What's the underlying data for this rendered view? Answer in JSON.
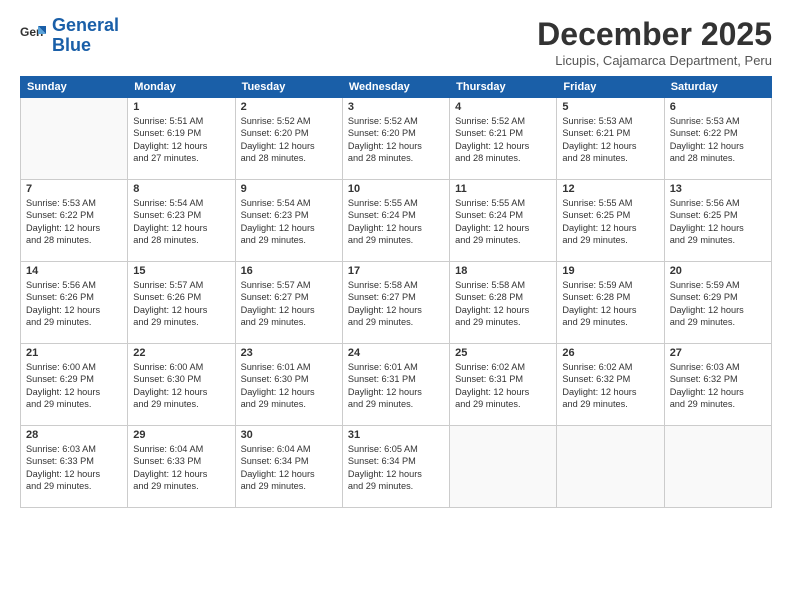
{
  "header": {
    "logo_line1": "General",
    "logo_line2": "Blue",
    "title": "December 2025",
    "subtitle": "Licupis, Cajamarca Department, Peru"
  },
  "days_of_week": [
    "Sunday",
    "Monday",
    "Tuesday",
    "Wednesday",
    "Thursday",
    "Friday",
    "Saturday"
  ],
  "weeks": [
    [
      {
        "num": "",
        "info": ""
      },
      {
        "num": "1",
        "info": "Sunrise: 5:51 AM\nSunset: 6:19 PM\nDaylight: 12 hours\nand 27 minutes."
      },
      {
        "num": "2",
        "info": "Sunrise: 5:52 AM\nSunset: 6:20 PM\nDaylight: 12 hours\nand 28 minutes."
      },
      {
        "num": "3",
        "info": "Sunrise: 5:52 AM\nSunset: 6:20 PM\nDaylight: 12 hours\nand 28 minutes."
      },
      {
        "num": "4",
        "info": "Sunrise: 5:52 AM\nSunset: 6:21 PM\nDaylight: 12 hours\nand 28 minutes."
      },
      {
        "num": "5",
        "info": "Sunrise: 5:53 AM\nSunset: 6:21 PM\nDaylight: 12 hours\nand 28 minutes."
      },
      {
        "num": "6",
        "info": "Sunrise: 5:53 AM\nSunset: 6:22 PM\nDaylight: 12 hours\nand 28 minutes."
      }
    ],
    [
      {
        "num": "7",
        "info": "Sunrise: 5:53 AM\nSunset: 6:22 PM\nDaylight: 12 hours\nand 28 minutes."
      },
      {
        "num": "8",
        "info": "Sunrise: 5:54 AM\nSunset: 6:23 PM\nDaylight: 12 hours\nand 28 minutes."
      },
      {
        "num": "9",
        "info": "Sunrise: 5:54 AM\nSunset: 6:23 PM\nDaylight: 12 hours\nand 29 minutes."
      },
      {
        "num": "10",
        "info": "Sunrise: 5:55 AM\nSunset: 6:24 PM\nDaylight: 12 hours\nand 29 minutes."
      },
      {
        "num": "11",
        "info": "Sunrise: 5:55 AM\nSunset: 6:24 PM\nDaylight: 12 hours\nand 29 minutes."
      },
      {
        "num": "12",
        "info": "Sunrise: 5:55 AM\nSunset: 6:25 PM\nDaylight: 12 hours\nand 29 minutes."
      },
      {
        "num": "13",
        "info": "Sunrise: 5:56 AM\nSunset: 6:25 PM\nDaylight: 12 hours\nand 29 minutes."
      }
    ],
    [
      {
        "num": "14",
        "info": "Sunrise: 5:56 AM\nSunset: 6:26 PM\nDaylight: 12 hours\nand 29 minutes."
      },
      {
        "num": "15",
        "info": "Sunrise: 5:57 AM\nSunset: 6:26 PM\nDaylight: 12 hours\nand 29 minutes."
      },
      {
        "num": "16",
        "info": "Sunrise: 5:57 AM\nSunset: 6:27 PM\nDaylight: 12 hours\nand 29 minutes."
      },
      {
        "num": "17",
        "info": "Sunrise: 5:58 AM\nSunset: 6:27 PM\nDaylight: 12 hours\nand 29 minutes."
      },
      {
        "num": "18",
        "info": "Sunrise: 5:58 AM\nSunset: 6:28 PM\nDaylight: 12 hours\nand 29 minutes."
      },
      {
        "num": "19",
        "info": "Sunrise: 5:59 AM\nSunset: 6:28 PM\nDaylight: 12 hours\nand 29 minutes."
      },
      {
        "num": "20",
        "info": "Sunrise: 5:59 AM\nSunset: 6:29 PM\nDaylight: 12 hours\nand 29 minutes."
      }
    ],
    [
      {
        "num": "21",
        "info": "Sunrise: 6:00 AM\nSunset: 6:29 PM\nDaylight: 12 hours\nand 29 minutes."
      },
      {
        "num": "22",
        "info": "Sunrise: 6:00 AM\nSunset: 6:30 PM\nDaylight: 12 hours\nand 29 minutes."
      },
      {
        "num": "23",
        "info": "Sunrise: 6:01 AM\nSunset: 6:30 PM\nDaylight: 12 hours\nand 29 minutes."
      },
      {
        "num": "24",
        "info": "Sunrise: 6:01 AM\nSunset: 6:31 PM\nDaylight: 12 hours\nand 29 minutes."
      },
      {
        "num": "25",
        "info": "Sunrise: 6:02 AM\nSunset: 6:31 PM\nDaylight: 12 hours\nand 29 minutes."
      },
      {
        "num": "26",
        "info": "Sunrise: 6:02 AM\nSunset: 6:32 PM\nDaylight: 12 hours\nand 29 minutes."
      },
      {
        "num": "27",
        "info": "Sunrise: 6:03 AM\nSunset: 6:32 PM\nDaylight: 12 hours\nand 29 minutes."
      }
    ],
    [
      {
        "num": "28",
        "info": "Sunrise: 6:03 AM\nSunset: 6:33 PM\nDaylight: 12 hours\nand 29 minutes."
      },
      {
        "num": "29",
        "info": "Sunrise: 6:04 AM\nSunset: 6:33 PM\nDaylight: 12 hours\nand 29 minutes."
      },
      {
        "num": "30",
        "info": "Sunrise: 6:04 AM\nSunset: 6:34 PM\nDaylight: 12 hours\nand 29 minutes."
      },
      {
        "num": "31",
        "info": "Sunrise: 6:05 AM\nSunset: 6:34 PM\nDaylight: 12 hours\nand 29 minutes."
      },
      {
        "num": "",
        "info": ""
      },
      {
        "num": "",
        "info": ""
      },
      {
        "num": "",
        "info": ""
      }
    ]
  ]
}
